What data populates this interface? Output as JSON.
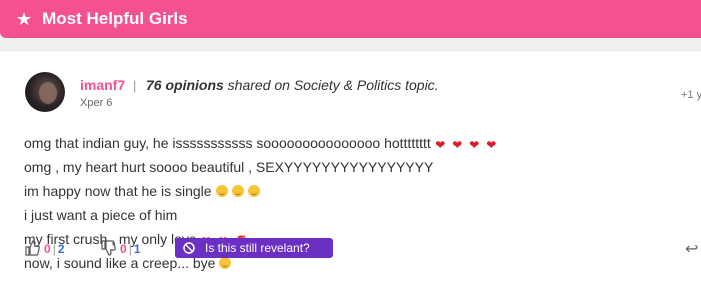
{
  "header": {
    "title": "Most Helpful Girls",
    "icon": "star-icon"
  },
  "post": {
    "username": "imanf7",
    "separator": "|",
    "opinions_count": "76 opinions",
    "opinions_suffix": " shared on Society & Politics topic.",
    "rank": "Xper 6",
    "time": "+1 y",
    "lines": [
      "omg that indian guy, he isssssssssss sooooooooooooooo hotttttttt",
      "omg , my heart hurt soooo beautiful , SEXYYYYYYYYYYYYYYYY",
      "im happy now that he is single",
      "i just want a piece of him",
      "my first crush , my only love",
      "now, i sound like a creep... bye"
    ]
  },
  "footer": {
    "like_count_a": "0",
    "like_count_b": "2",
    "dislike_count_a": "0",
    "dislike_count_b": "1",
    "relevant_label": "Is this still revelant?"
  },
  "colors": {
    "brand": "#f5508f",
    "button": "#6b2fc3"
  }
}
